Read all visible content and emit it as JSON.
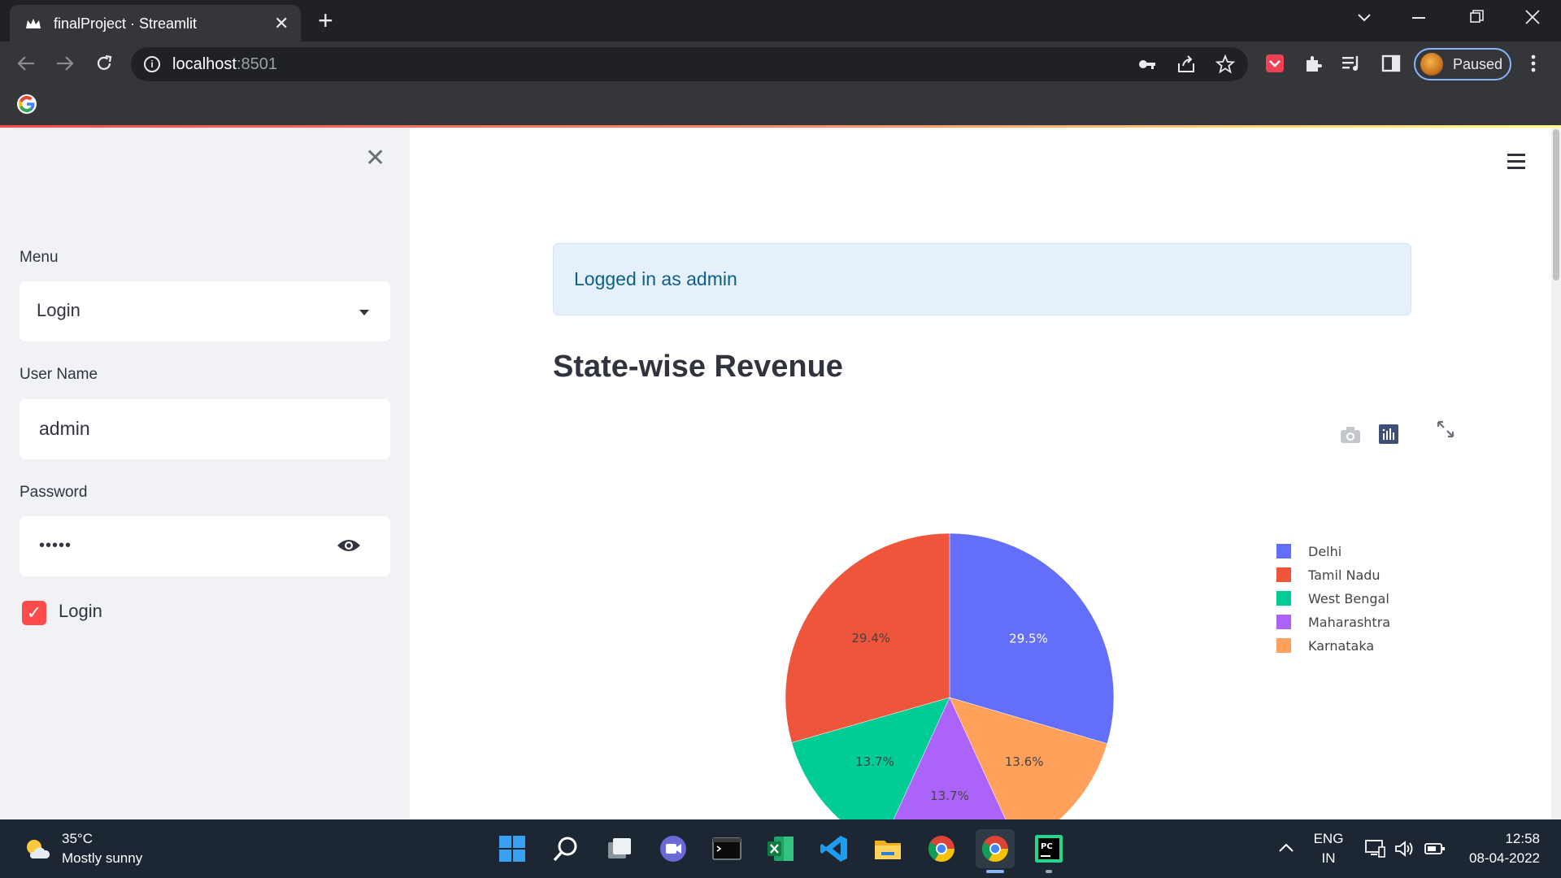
{
  "browser": {
    "tab_title": "finalProject · Streamlit",
    "tab_close": "✕",
    "new_tab": "+",
    "url_host": "localhost",
    "url_port": ":8501",
    "profile_label": "Paused"
  },
  "sidebar": {
    "close_glyph": "✕",
    "menu_label": "Menu",
    "menu_selected": "Login",
    "username_label": "User Name",
    "username_value": "admin",
    "password_label": "Password",
    "password_mask": "•••••",
    "checkbox_label": "Login",
    "checkbox_checked": true
  },
  "main": {
    "alert_text": "Logged in as admin",
    "page_title": "State-wise Revenue"
  },
  "chart_data": {
    "type": "pie",
    "labels": [
      "Delhi",
      "Tamil Nadu",
      "West Bengal",
      "Maharashtra",
      "Karnataka"
    ],
    "values": [
      29.5,
      29.4,
      13.7,
      13.7,
      13.6
    ],
    "value_labels": [
      "29.5%",
      "29.4%",
      "13.7%",
      "13.7%",
      "13.6%"
    ],
    "colors": [
      "#636efa",
      "#ef553b",
      "#00cc96",
      "#ab63fa",
      "#ffa15a"
    ],
    "legend": {
      "position": "right"
    }
  },
  "taskbar": {
    "temperature": "35°C",
    "weather": "Mostly sunny",
    "language_line1": "ENG",
    "language_line2": "IN",
    "time": "12:58",
    "date": "08-04-2022"
  }
}
